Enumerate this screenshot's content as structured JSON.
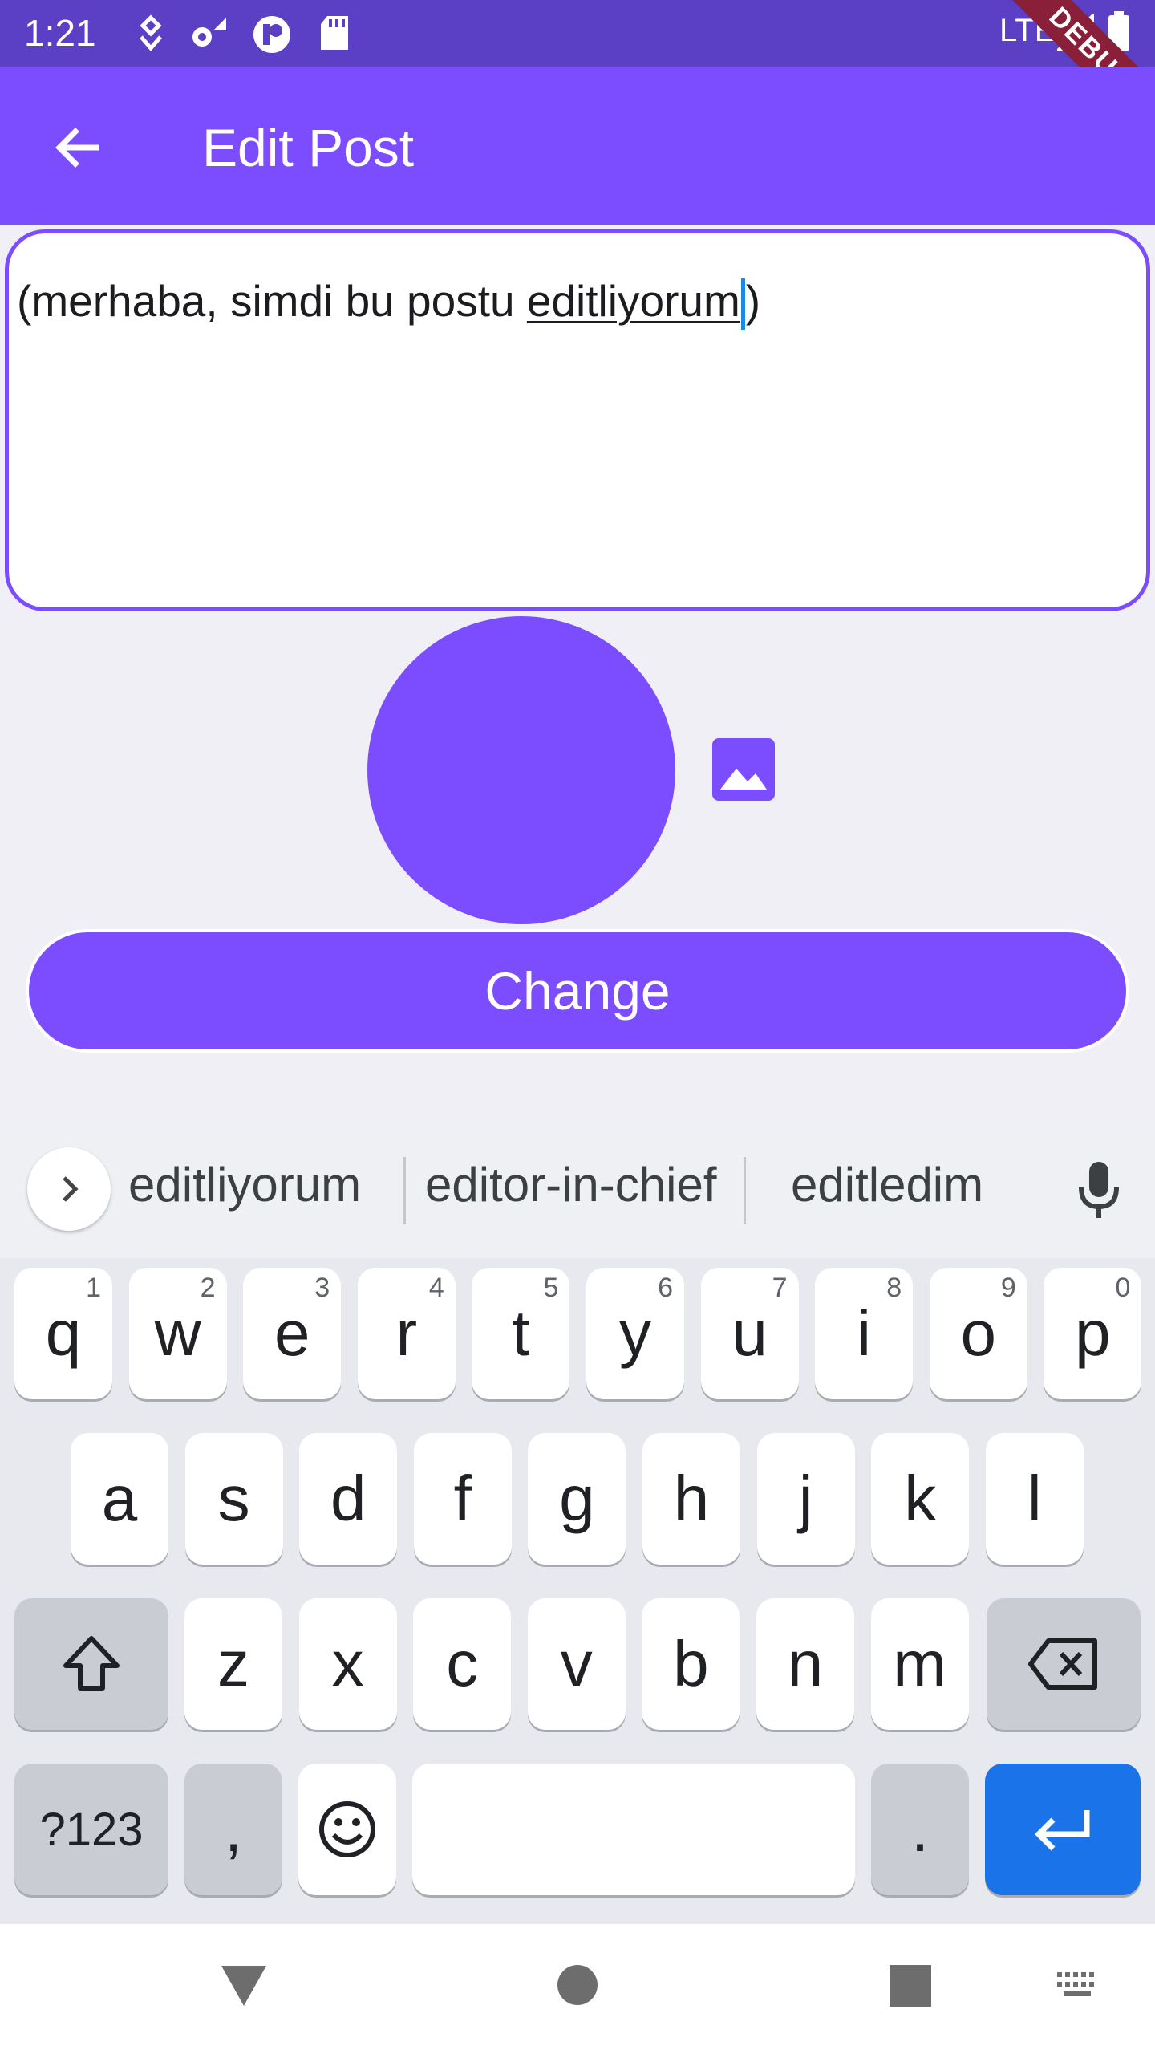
{
  "status_bar": {
    "time": "1:21",
    "network": "LTE",
    "debug_label": "DEBUG"
  },
  "app_bar": {
    "title": "Edit Post"
  },
  "editor": {
    "text_before": "(merhaba, simdi bu postu ",
    "text_underlined": "editliyorum",
    "text_after": ")"
  },
  "image": {
    "color": "#7c4dff"
  },
  "change_button": {
    "label": "Change"
  },
  "keyboard": {
    "suggestions": [
      "editliyorum",
      "editor-in-chief",
      "editledim"
    ],
    "row1": [
      {
        "k": "q",
        "n": "1"
      },
      {
        "k": "w",
        "n": "2"
      },
      {
        "k": "e",
        "n": "3"
      },
      {
        "k": "r",
        "n": "4"
      },
      {
        "k": "t",
        "n": "5"
      },
      {
        "k": "y",
        "n": "6"
      },
      {
        "k": "u",
        "n": "7"
      },
      {
        "k": "i",
        "n": "8"
      },
      {
        "k": "o",
        "n": "9"
      },
      {
        "k": "p",
        "n": "0"
      }
    ],
    "row2": [
      "a",
      "s",
      "d",
      "f",
      "g",
      "h",
      "j",
      "k",
      "l"
    ],
    "row3": [
      "z",
      "x",
      "c",
      "v",
      "b",
      "n",
      "m"
    ],
    "symbols_label": "?123",
    "comma_label": ",",
    "period_label": "."
  },
  "colors": {
    "accent": "#7c4dff",
    "status_bar": "#5b3fc4",
    "enter_key": "#1a73e8"
  }
}
